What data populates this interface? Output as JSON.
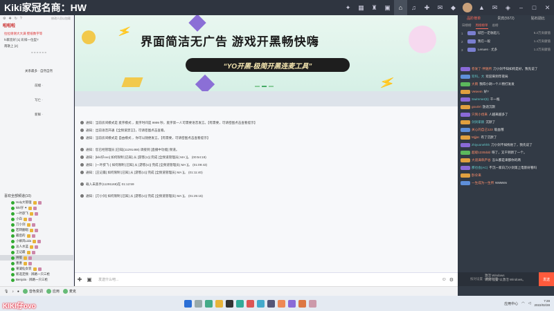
{
  "app": {
    "name": "Kiki家冠名商：HW",
    "titlebar_icons": [
      "sparkle-icon",
      "grid-icon",
      "tshirt-icon",
      "box-icon",
      "home-icon",
      "mic-icon",
      "gamepad-icon",
      "gift-icon",
      "game-icon",
      "avatar",
      "shirt-icon",
      "mail-icon",
      "shield-icon",
      "minus-icon",
      "maximize-icon",
      "close-icon"
    ]
  },
  "left": {
    "toolbar_note": "修改人员以加载",
    "channel_title": "啦啦啦",
    "lines": [
      {
        "text": "拉拉谢谢大大满  壁纸数字等",
        "red": true
      },
      {
        "text": "hi家您好 [1] 彩排一位型?",
        "red": false
      },
      {
        "text": "南歌上 [2]",
        "red": false
      },
      {
        "text": "= = = = = =",
        "red": false
      },
      {
        "text": "关系最多 · 自然自然",
        "red": false
      },
      {
        "text": "前缀 ·",
        "red": false
      },
      {
        "text": "写亡 ·",
        "red": false
      },
      {
        "text": "新鲜 ·",
        "red": false
      }
    ],
    "sub_header": "喜欢全部频道(10)",
    "members": [
      {
        "name": "Holy大管理",
        "sel": false
      },
      {
        "name": "kiki仔 ✦",
        "sel": false
      },
      {
        "name": "一叶欲飞",
        "sel": false
      },
      {
        "name": "小白",
        "sel": false
      },
      {
        "name": "刀小剑",
        "sel": false
      },
      {
        "name": "若转翻唱",
        "sel": false
      },
      {
        "name": "最后的",
        "sel": false
      },
      {
        "name": "小裤风Lida",
        "sel": false
      },
      {
        "name": "淡人水蓝",
        "sel": false
      },
      {
        "name": "王记最",
        "sel": false
      },
      {
        "name": "拼版",
        "sel": true
      },
      {
        "name": "墨墨",
        "sel": false
      },
      {
        "name": "果凝仙女装",
        "sel": false
      },
      {
        "name": "新选定频 · 辨路一只三枪",
        "sel": false
      },
      {
        "name": "Benjola · 辨路一只三枪",
        "sel": false
      }
    ]
  },
  "banner": {
    "headline": "界面简洁无广告  游戏开黑畅快嗨",
    "pill": "“YO开黑-极简开黑连麦工具”"
  },
  "log": [
    "通知：当前房间模式是 麦序模式 ，麦序时间是 9999 秒，麦序第一人可需要语音发言。【有需要，可请密图点击查看提示】",
    "通知：出前语音开通【全频道禁言】，可请密图点击查看。",
    "通知：当前房间模式是 自由模式 ，你可以随便发言。【有需要，可请密图点击查看提示】",
    "通知：您已经管理员 [已知](11291468) 调接到 [直播中功能] 频道。",
    "通知：[kiki仔ovo] 如何限制 [已知] 从 [游客(U)] 完成 [全频道管理员( MA )]。 (00:54:19)",
    "通知：[一叶欲飞·] 如何限制 [已知] 从 [游客(U)] 完成 [全频道管理员( MA )]。 (01:09:43)",
    "通知：[王记最] 如何限制 [已知] 从 [游客(U)] 完成 [全频道管理员( MA )]。 (01:11:40)",
    "载入未黑手(11291168)在 01:12:59",
    "通知：[刀小剑] 如何限制 [已知] 从 [游客(U)] 完成 [全频道管理员( MA )]。 (01:25:15)"
  ],
  "input": {
    "placeholder": "发送什么吧..."
  },
  "right": {
    "tabs": [
      "品阶榜单",
      "贵宾(5572)",
      "贴石勋比"
    ],
    "subtabs": [
      "日榜榜",
      "周榜榜单",
      "总榜"
    ],
    "ranks": [
      {
        "num": "1",
        "name": "城巴一定收超儿",
        "val": "5.2万贡献值"
      },
      {
        "num": "2",
        "name": "我在一般",
        "val": "1.4万贡献值"
      },
      {
        "num": "3",
        "name": "Lenuen · 尤多",
        "val": "1.2万贡献值"
      }
    ],
    "chat": [
      {
        "nick": "卷发了·伴随所",
        "msg": "刀小剑不知如何是好，我先说了",
        "lv": "purple"
      },
      {
        "nick": "欢吗，大",
        "msg": "欢迎来到年夜局",
        "lv": "blue"
      },
      {
        "nick": "大雨",
        "msg": "我得小剃一个人物打发发",
        "lv": "green"
      },
      {
        "nick": "Veteem",
        "msg": "好?",
        "lv": "orange"
      },
      {
        "nick": "Swimmer(5)",
        "msg": "千一瓶",
        "lv": "purple"
      },
      {
        "nick": "gouOri",
        "msg": "放逝沉默",
        "lv": "orange"
      },
      {
        "nick": "只到小伐来",
        "msg": "人越来越多了",
        "lv": "purple"
      },
      {
        "nick": "剑剑家鹃",
        "msg": "沉默了",
        "lv": "orange"
      },
      {
        "nick": "关心的自己123",
        "msg": "吸血哦",
        "lv": "blue"
      },
      {
        "nick": "Mjjjsc",
        "msg": "有了沉默了",
        "lv": "orange"
      },
      {
        "nick": "zhiyuonehhh",
        "msg": "刀小剑不如找他了，我先说了",
        "lv": "purple"
      },
      {
        "nick": "超级1230ddd",
        "msg": "呀了，又干到新了一个。",
        "lv": "green"
      },
      {
        "nick": "大道满草庐谷",
        "msg": "怎么都是来都你的两",
        "lv": "orange"
      },
      {
        "nick": "那也会(AC)",
        "msg": "不沉一家白刀小剑第上电影好看吗",
        "lv": "purple"
      },
      {
        "nick": "卧伞来",
        "msg": "",
        "lv": "orange"
      },
      {
        "nick": "一生成为一生所",
        "msg": "NNNNN",
        "lv": "blue"
      }
    ],
    "input_placeholder": "按对设置 · 发送对话...",
    "send": "发送"
  },
  "bottom": {
    "items": [
      "音色变调",
      "应用",
      "麦克"
    ],
    "overlay": "KIKI仔ovo"
  },
  "taskbar": {
    "time": "7:28",
    "date": "2022/02/28",
    "tray_text": "应用中心"
  },
  "watermark": [
    "激活 Windows",
    "转到\"设置\"以激活 Windows。"
  ]
}
